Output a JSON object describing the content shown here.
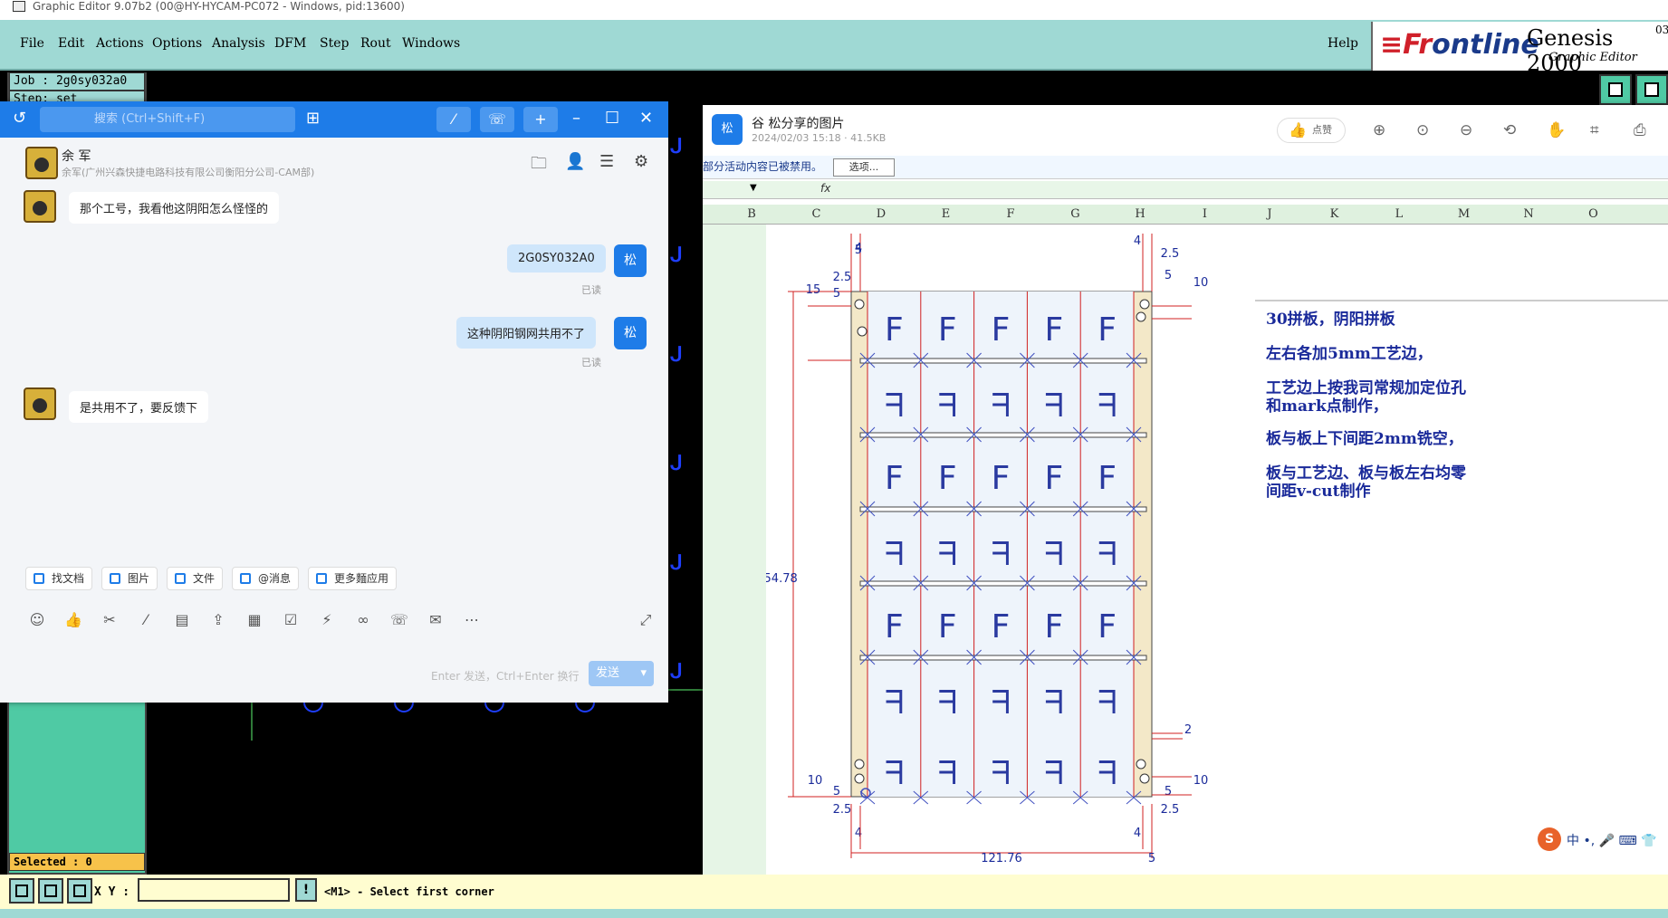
{
  "window": {
    "title": "Graphic Editor 9.07b2 (00@HY-HYCAM-PC072 - Windows, pid:13600)"
  },
  "menubar": {
    "items": [
      "File",
      "Edit",
      "Actions",
      "Options",
      "Analysis",
      "DFM",
      "Step",
      "Rout",
      "Windows"
    ],
    "help": "Help"
  },
  "branding": {
    "logo_prefix": "≡Fr",
    "logo_rest": "ontline",
    "product": "Genesis 2000",
    "sup": "03",
    "subtitle": "Graphic Editor"
  },
  "leftpanel": {
    "job": "Job  :  2g0sy032a0",
    "step": "Step:  set",
    "selected": "Selected : 0"
  },
  "statusbar": {
    "xy_label": "X Y :",
    "xy_value": "",
    "excl": "!",
    "hint": "<M1> - Select first corner"
  },
  "chat": {
    "search_placeholder": "搜索 (Ctrl+Shift+F)",
    "contact_name": "余 军",
    "contact_org": "余军(广州兴森快捷电路科技有限公司衡阳分公司-CAM部)",
    "me_avatar": "松",
    "messages": [
      {
        "from": "other",
        "text": "那个工号，我看他这阴阳怎么怪怪的"
      },
      {
        "from": "me",
        "text": "2G0SY032A0",
        "status": "已读"
      },
      {
        "from": "me",
        "text": "这种阴阳钢网共用不了",
        "status": "已读"
      },
      {
        "from": "other",
        "text": "是共用不了，要反馈下"
      }
    ],
    "pills": [
      "找文档",
      "图片",
      "文件",
      "@消息",
      "更多麵应用"
    ],
    "enter_hint": "Enter 发送，Ctrl+Enter 换行",
    "send_label": "发送"
  },
  "viewer": {
    "logo": "松",
    "title": "谷  松分享的图片",
    "meta": "2024/02/03 15:18 · 41.5KB",
    "like": "点赞",
    "warn": "部分活动内容已被禁用。",
    "options": "选项...",
    "fx": "fx",
    "columns": [
      "B",
      "C",
      "D",
      "E",
      "F",
      "G",
      "H",
      "I",
      "J",
      "K",
      "L",
      "M",
      "N",
      "O"
    ],
    "dims": {
      "top5": "5",
      "top4": "4",
      "left2_5": "2.5",
      "left15": "15",
      "left5": "5",
      "right4": "4",
      "right2_5": "2.5",
      "right5": "5",
      "right10": "10",
      "height": "154.78",
      "width": "121.76",
      "right2": "2",
      "bl10": "10",
      "bl5": "5",
      "bl2_5": "2.5",
      "bl4": "4",
      "br5": "5",
      "br10": "10",
      "br2_5": "2.5",
      "br4": "4",
      "bw5": "5"
    },
    "notes": [
      "30拼板，阴阳拼板",
      "左右各加5mm工艺边，",
      "工艺边上按我司常规加定位孔",
      "和mark点制作，",
      "板与板上下间距2mm铣空，",
      "板与工艺边、板与板左右均零",
      "间距v-cut制作"
    ]
  },
  "ime": {
    "logo": "S",
    "text": "中 •, 🎤 ⌨ 👕"
  },
  "colors": {
    "genesis_teal": "#9fd9d4",
    "genesis_green": "#4fcaa4",
    "accent": "#1e7ce8"
  }
}
